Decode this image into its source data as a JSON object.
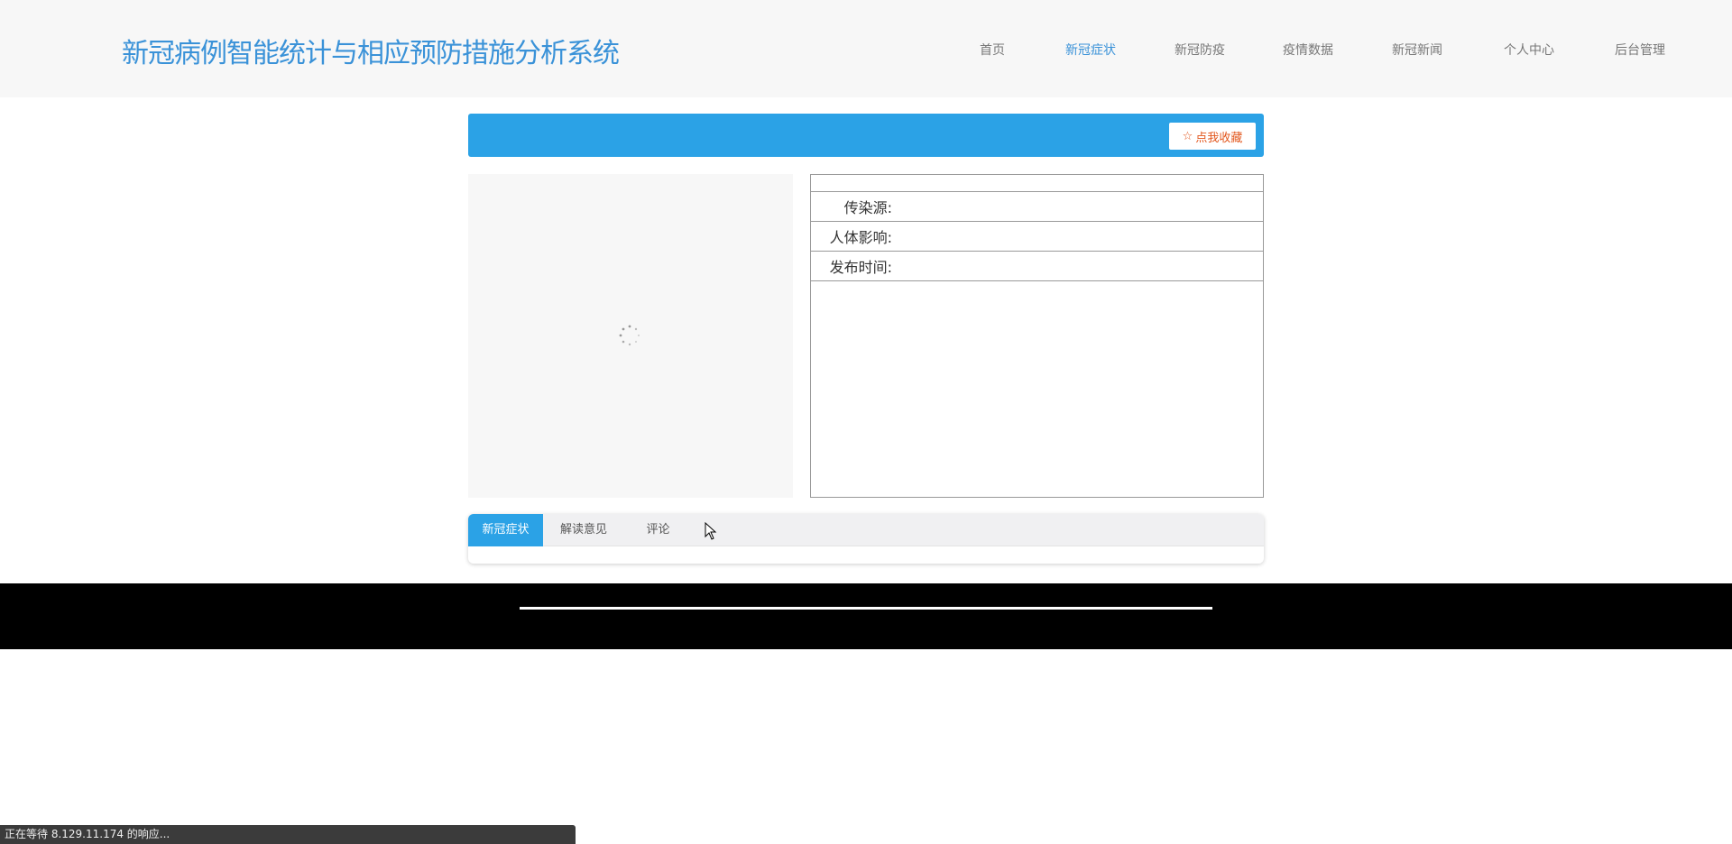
{
  "header": {
    "title": "新冠病例智能统计与相应预防措施分析系统",
    "nav": [
      {
        "label": "首页"
      },
      {
        "label": "新冠症状"
      },
      {
        "label": "新冠防疫"
      },
      {
        "label": "疫情数据"
      },
      {
        "label": "新冠新闻"
      },
      {
        "label": "个人中心"
      },
      {
        "label": "后台管理"
      }
    ],
    "active_nav": "新冠症状"
  },
  "banner": {
    "favorite_label": "点我收藏",
    "favorite_icon": "star-outline-icon"
  },
  "info": {
    "rows": [
      {
        "label": "传染源:",
        "value": ""
      },
      {
        "label": "人体影响:",
        "value": ""
      },
      {
        "label": "发布时间:",
        "value": ""
      }
    ]
  },
  "tabs": [
    {
      "label": "新冠症状",
      "active": true
    },
    {
      "label": "解读意见"
    },
    {
      "label": "评论"
    }
  ],
  "status_bar": {
    "text": "正在等待 8.129.11.174 的响应..."
  },
  "colors": {
    "accent": "#2ba2e6",
    "title": "#3a92d8",
    "favorite": "#e2561c"
  }
}
